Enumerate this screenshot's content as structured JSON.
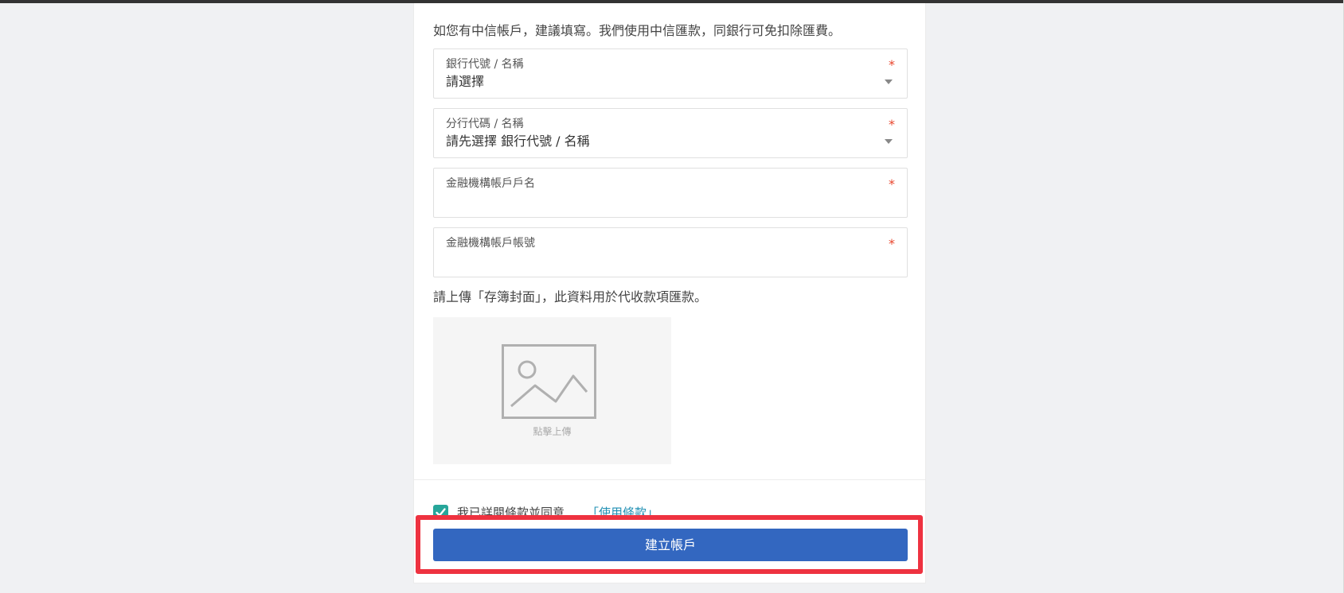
{
  "intro_note": "如您有中信帳戶，建議填寫。我們使用中信匯款，同銀行可免扣除匯費。",
  "fields": [
    {
      "label": "銀行代號 / 名稱",
      "value": "請選擇",
      "required": "*"
    },
    {
      "label": "分行代碼 / 名稱",
      "value": "請先選擇 銀行代號 / 名稱",
      "required": "*"
    },
    {
      "label": "金融機構帳戶戶名",
      "value": "",
      "required": "*"
    },
    {
      "label": "金融機構帳戶帳號",
      "value": "",
      "required": "*"
    }
  ],
  "upload": {
    "instruction": "請上傳「存簿封面」，此資料用於代收款項匯款。",
    "button_text": "點擊上傳"
  },
  "agreement": {
    "checked": true,
    "text": "我已詳閱條款並同意",
    "link": "「使用條款」"
  },
  "submit_label": "建立帳戶",
  "colors": {
    "primary": "#3367c0",
    "checkbox": "#26a69a",
    "required": "#e8452c",
    "highlight": "#ee3240",
    "link": "#1f8fb3"
  }
}
